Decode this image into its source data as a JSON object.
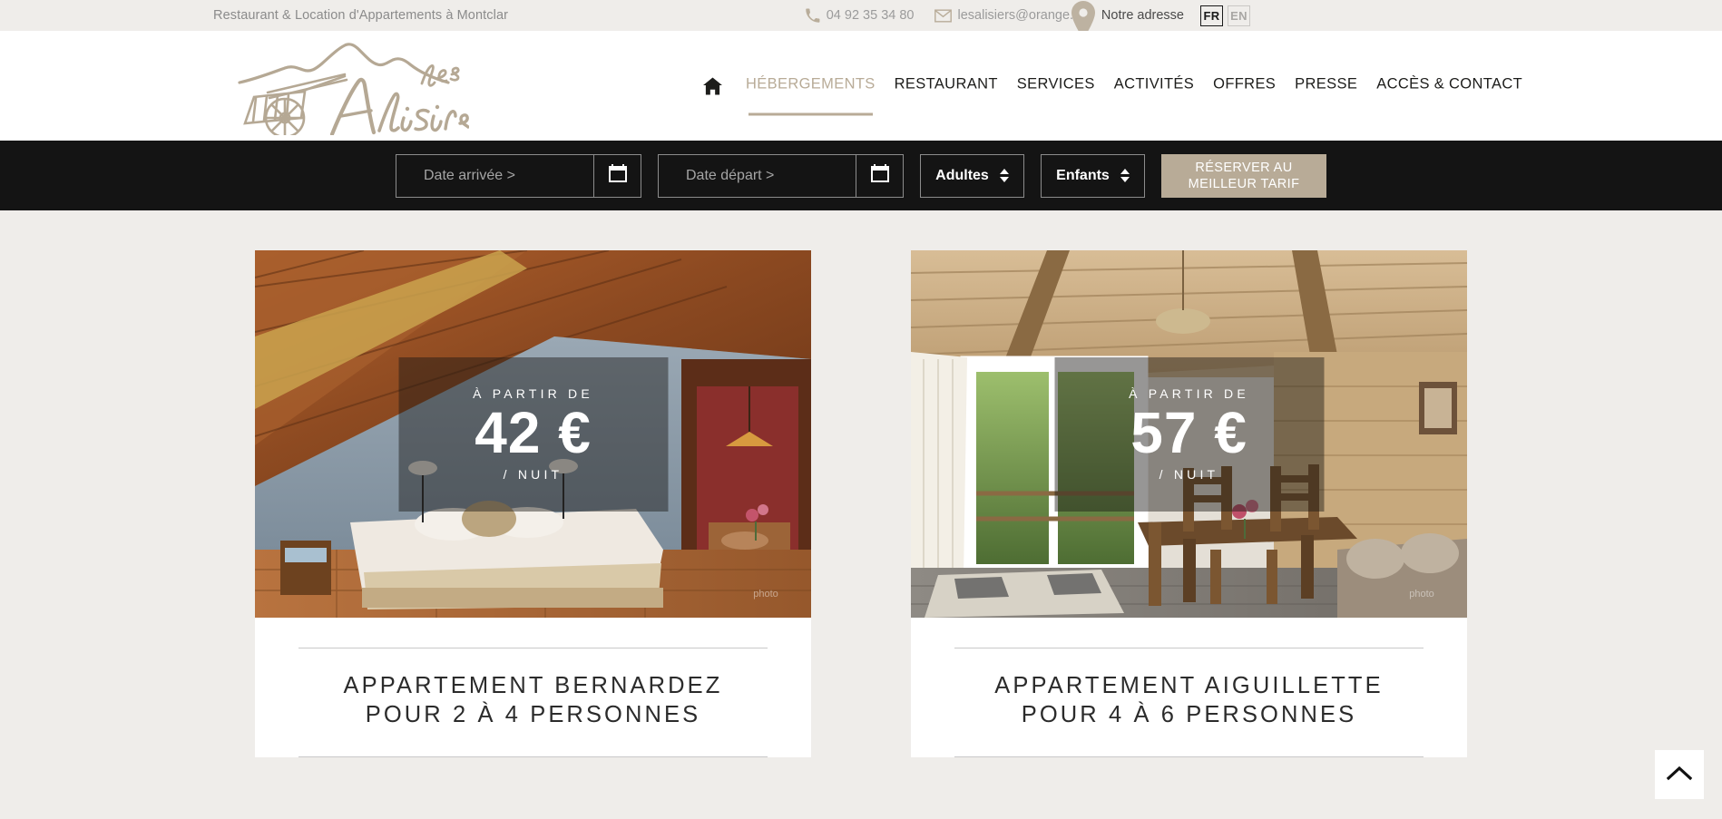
{
  "topbar": {
    "tagline": "Restaurant & Location d'Appartements à Montclar",
    "phone": "04 92 35 34 80",
    "email": "lesalisiers@orange.fr",
    "address_label": "Notre adresse",
    "phone_icon": "phone-icon",
    "email_icon": "envelope-icon",
    "address_icon": "map-pin-icon",
    "languages": [
      {
        "code": "FR",
        "active": true
      },
      {
        "code": "EN",
        "active": false
      }
    ]
  },
  "header": {
    "logo_alt": "les Alisiers",
    "home_icon": "home-icon",
    "nav": [
      {
        "label": "HÉBERGEMENTS",
        "active": true
      },
      {
        "label": "RESTAURANT",
        "active": false
      },
      {
        "label": "SERVICES",
        "active": false
      },
      {
        "label": "ACTIVITÉS",
        "active": false
      },
      {
        "label": "OFFRES",
        "active": false
      },
      {
        "label": "PRESSE",
        "active": false
      },
      {
        "label": "ACCÈS & CONTACT",
        "active": false
      }
    ]
  },
  "booking": {
    "arrival_placeholder": "Date arrivée >",
    "departure_placeholder": "Date départ >",
    "arrival_value": "",
    "departure_value": "",
    "adults_label": "Adultes",
    "children_label": "Enfants",
    "calendar_icon": "calendar-icon",
    "stepper_icon": "updown-arrows-icon",
    "cta_line1": "RÉSERVER AU",
    "cta_line2": "MEILLEUR TARIF",
    "cta_color": "#b8ab97"
  },
  "cards": [
    {
      "price_from": "À PARTIR DE",
      "price_amount": "42 €",
      "price_unit": "/ NUIT",
      "title_line1": "APPARTEMENT BERNARDEZ",
      "title_line2": "POUR 2 À 4 PERSONNES",
      "photo_alt": "Chambre mansardée avec lit double"
    },
    {
      "price_from": "À PARTIR DE",
      "price_amount": "57 €",
      "price_unit": "/ NUIT",
      "title_line1": "APPARTEMENT AIGUILLETTE",
      "title_line2": "POUR 4 À 6 PERSONNES",
      "photo_alt": "Salle à manger avec accès balcon"
    }
  ],
  "scrolltop": {
    "icon": "chevron-up-icon",
    "label": "Haut de page"
  },
  "colors": {
    "page_bg": "#efedea",
    "bookbar_bg": "#141414",
    "accent": "#b8ab97",
    "text_dark": "#1d1d1b"
  }
}
